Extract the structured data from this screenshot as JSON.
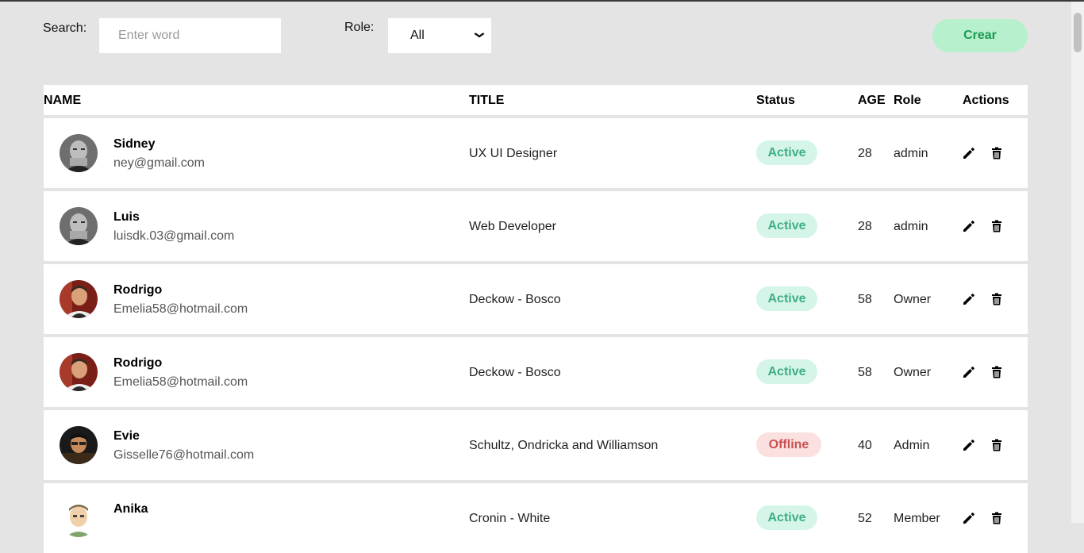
{
  "toolbar": {
    "search_label": "Search:",
    "search_placeholder": "Enter word",
    "role_label": "Role:",
    "role_value": "All",
    "create_label": "Crear"
  },
  "table": {
    "headers": {
      "name": "NAME",
      "title": "TITLE",
      "status": "Status",
      "age": "AGE",
      "role": "Role",
      "actions": "Actions"
    },
    "rows": [
      {
        "name": "Sidney",
        "email": "ney@gmail.com",
        "title": "UX UI Designer",
        "status": "Active",
        "age": "28",
        "role": "admin",
        "avatar": "bald-man-grey"
      },
      {
        "name": "Luis",
        "email": "luisdk.03@gmail.com",
        "title": "Web Developer",
        "status": "Active",
        "age": "28",
        "role": "admin",
        "avatar": "bald-man-grey"
      },
      {
        "name": "Rodrigo",
        "email": "Emelia58@hotmail.com",
        "title": "Deckow - Bosco",
        "status": "Active",
        "age": "58",
        "role": "Owner",
        "avatar": "man-red-bg"
      },
      {
        "name": "Rodrigo",
        "email": "Emelia58@hotmail.com",
        "title": "Deckow - Bosco",
        "status": "Active",
        "age": "58",
        "role": "Owner",
        "avatar": "man-red-bg"
      },
      {
        "name": "Evie",
        "email": "Gisselle76@hotmail.com",
        "title": "Schultz, Ondricka and Williamson",
        "status": "Offline",
        "age": "40",
        "role": "Admin",
        "avatar": "man-dark-glasses"
      },
      {
        "name": "Anika",
        "email": "",
        "title": "Cronin - White",
        "status": "Active",
        "age": "52",
        "role": "Member",
        "avatar": "cartoon-man"
      }
    ]
  },
  "colors": {
    "active_bg": "#d4f5e8",
    "active_text": "#3fae86",
    "offline_bg": "#fbe0e0",
    "offline_text": "#c85252",
    "create_bg": "#b6f0cd",
    "create_text": "#1b9a52"
  },
  "icons": {
    "edit": "pencil-icon",
    "delete": "trash-icon"
  }
}
